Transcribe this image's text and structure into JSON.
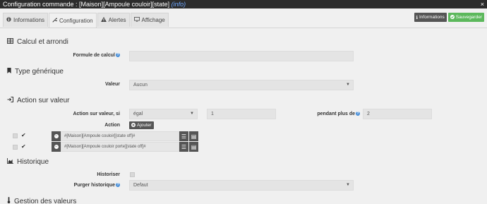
{
  "window": {
    "title": "Configuration commande : [Maison][Ampoule couloir][state]",
    "info": "(info)",
    "close": "×"
  },
  "tabs": [
    {
      "label": "Informations",
      "icon": "info-circle-icon"
    },
    {
      "label": "Configuration",
      "icon": "wrench-icon"
    },
    {
      "label": "Alertes",
      "icon": "warning-icon"
    },
    {
      "label": "Affichage",
      "icon": "monitor-icon"
    }
  ],
  "toolbar": {
    "info_label": "Informations",
    "save_label": "Sauvegarder"
  },
  "sections": {
    "calcul": "Calcul et arrondi",
    "type": "Type générique",
    "action": "Action sur valeur",
    "historique": "Historique",
    "gestion": "Gestion des valeurs"
  },
  "calcul": {
    "formule_label": "Formule de calcul",
    "formule_value": ""
  },
  "type": {
    "valeur_label": "Valeur",
    "valeur_value": "Aucun"
  },
  "action": {
    "si_label": "Action sur valeur, si",
    "operator": "égal",
    "value": "1",
    "pendant_label": "pendant plus de",
    "pendant_value": "2",
    "action_label": "Action",
    "add_label": "Ajouter",
    "rows": [
      {
        "command": "#[Maison][Ampoule couloir][state off]#"
      },
      {
        "command": "#[Maison][Ampoule couloir porte][state off]#"
      }
    ]
  },
  "historique": {
    "historiser_label": "Historiser",
    "purger_label": "Purger historique",
    "purger_value": "Defaut"
  },
  "colors": {
    "titlebar": "#2c2c2c",
    "save": "#5cb85c",
    "dark_button": "#555555",
    "help": "#4a90d9"
  }
}
